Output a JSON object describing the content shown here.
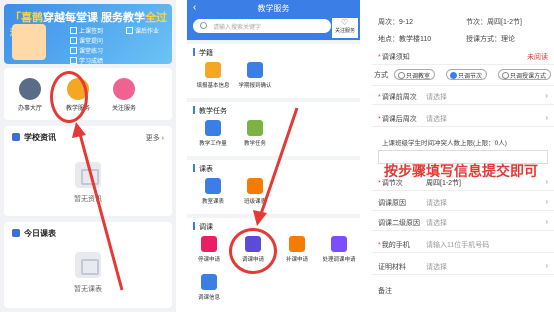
{
  "panel1": {
    "banner": {
      "title_part1": "「喜鹊",
      "title_part2": "穿越每堂课",
      "title_part3": " 服务教学",
      "title_part4": "全过程",
      "features": [
        "上课签到",
        "课堂提问",
        "课堂练习",
        "课后作业",
        "学习成绩"
      ]
    },
    "tiles": [
      {
        "label": "办事大厅",
        "icon": "building-icon",
        "color": "#5b6c86"
      },
      {
        "label": "教学服务",
        "icon": "service-icon",
        "color": "#f5a623"
      },
      {
        "label": "关注服务",
        "icon": "heart-icon",
        "color": "#f06292"
      }
    ],
    "news": {
      "title": "学校资讯",
      "more": "更多",
      "empty": "暂无资讯"
    },
    "schedule": {
      "title": "今日课表",
      "empty": "暂无课表"
    }
  },
  "panel2": {
    "title": "教学服务",
    "back": "‹",
    "search_placeholder": "请输入搜索关键字",
    "favorite": "关注服务",
    "sections": [
      {
        "title": "学籍",
        "apps": [
          {
            "label": "填报基本信息",
            "color": "#f5a623"
          },
          {
            "label": "学期报到确认",
            "color": "#3b7fe6"
          }
        ]
      },
      {
        "title": "教学任务",
        "apps": [
          {
            "label": "教学工作量",
            "color": "#3b7fe6"
          },
          {
            "label": "教学任务",
            "color": "#7cb342"
          }
        ]
      },
      {
        "title": "课表",
        "apps": [
          {
            "label": "教室课表",
            "color": "#3b7fe6"
          },
          {
            "label": "班级课表",
            "color": "#f57c00"
          }
        ]
      },
      {
        "title": "调课",
        "apps": [
          {
            "label": "停课申请",
            "color": "#e91e63"
          },
          {
            "label": "调课申请",
            "color": "#5c4bd8"
          },
          {
            "label": "补课申请",
            "color": "#f57c00"
          },
          {
            "label": "处理调课申请",
            "color": "#7c4dff"
          },
          {
            "label": "调课信息",
            "color": "#3b7fe6"
          }
        ]
      }
    ]
  },
  "panel3": {
    "weeks_label": "周次：",
    "weeks_value": "9-12",
    "section_label": "节次：",
    "section_value": "周四[1-2节]",
    "place_label": "地点：",
    "place_value": "教学楼110",
    "mode_label": "授课方式：",
    "mode_value": "理论",
    "notice_label": "调课须知",
    "notice_value": "未阅读",
    "type_label": "方式",
    "options": [
      "只调教室",
      "只调节次",
      "只调授课方式"
    ],
    "selected_option": "只调节次",
    "rows": [
      {
        "label": "调课前周次",
        "value": "请选择",
        "required": true
      },
      {
        "label": "调课后周次",
        "value": "请选择",
        "required": true
      }
    ],
    "cap_label": "上课班级学生时间冲突人数上限(上限：0人)",
    "section_row": {
      "label": "调节次",
      "value": "周四[1-2节]"
    },
    "reason1": {
      "label": "调课原因",
      "value": "请选择"
    },
    "reason2": {
      "label": "调课二级原因",
      "value": "请选择"
    },
    "phone": {
      "label": "我的手机",
      "value": "请输入11位手机号码"
    },
    "proof": {
      "label": "证明材料",
      "value": "请选择"
    },
    "remark": {
      "label": "备注"
    }
  },
  "annotation": {
    "instruction": "按步骤填写信息提交即可",
    "color": "#e53935"
  }
}
